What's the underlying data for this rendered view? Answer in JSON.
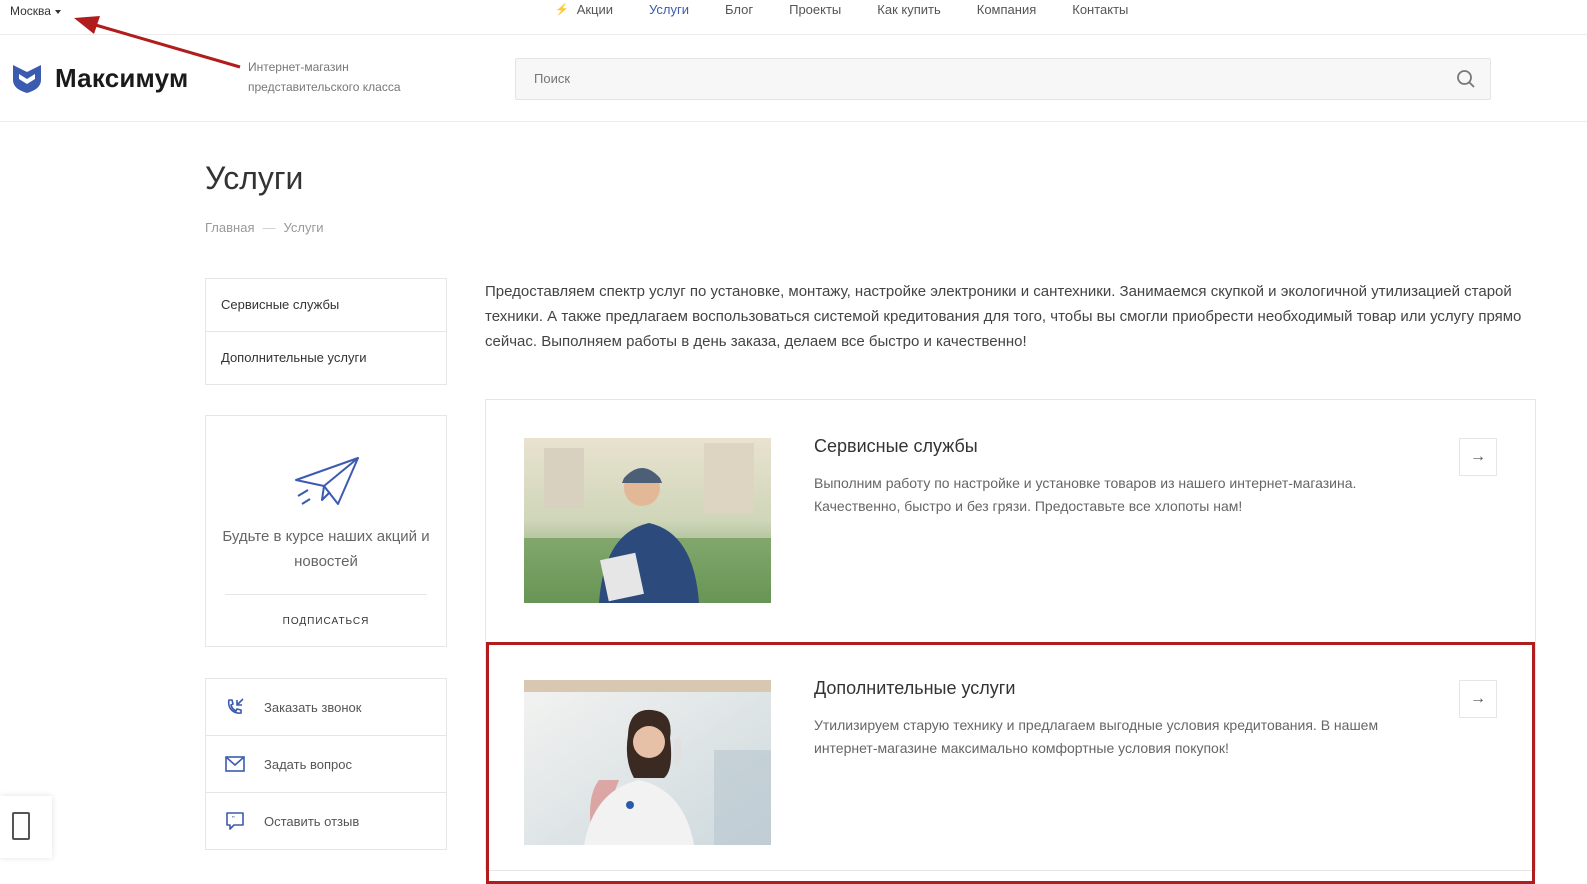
{
  "topbar": {
    "city": "Москва",
    "nav": [
      {
        "label": "Акции",
        "icon": "bolt-icon",
        "active": false
      },
      {
        "label": "Услуги",
        "active": true
      },
      {
        "label": "Блог",
        "active": false
      },
      {
        "label": "Проекты",
        "active": false
      },
      {
        "label": "Как купить",
        "active": false
      },
      {
        "label": "Компания",
        "active": false
      },
      {
        "label": "Контакты",
        "active": false
      }
    ]
  },
  "header": {
    "logo_text": "Максимум",
    "tagline": "Интернет-магазин представительского класса",
    "search_placeholder": "Поиск"
  },
  "page": {
    "title": "Услуги",
    "breadcrumb": [
      "Главная",
      "Услуги"
    ],
    "intro": "Предоставляем спектр услуг по установке, монтажу, настройке электроники и сантехники. Занимаемся скупкой и экологичной утилизацией старой техники. А также предлагаем воспользоваться системой кредитования для того, чтобы вы смогли приобрести необходимый товар или услугу прямо сейчас. Выполняем работы в день заказа, делаем все быстро и качественно!"
  },
  "sidebar": {
    "menu": [
      "Сервисные службы",
      "Дополнительные услуги"
    ],
    "subscribe": {
      "text": "Будьте в курсе наших акций и новостей",
      "button": "ПОДПИСАТЬСЯ"
    },
    "actions": [
      {
        "label": "Заказать звонок",
        "icon": "phone-callback-icon"
      },
      {
        "label": "Задать вопрос",
        "icon": "envelope-icon"
      },
      {
        "label": "Оставить отзыв",
        "icon": "review-chat-icon"
      }
    ]
  },
  "services": [
    {
      "title": "Сервисные службы",
      "description": "Выполним работу по настройке и установке товаров из нашего интернет-магазина. Качественно, быстро и без грязи. Предоставьте все хлопоты нам!",
      "highlighted": false
    },
    {
      "title": "Дополнительные услуги",
      "description": "Утилизируем старую технику и предлагаем выгодные условия кредитования. В нашем интернет-магазине максимально комфортные условия покупок!",
      "highlighted": true
    }
  ],
  "colors": {
    "accent": "#3b5bb0",
    "highlight": "#b11c1c"
  }
}
